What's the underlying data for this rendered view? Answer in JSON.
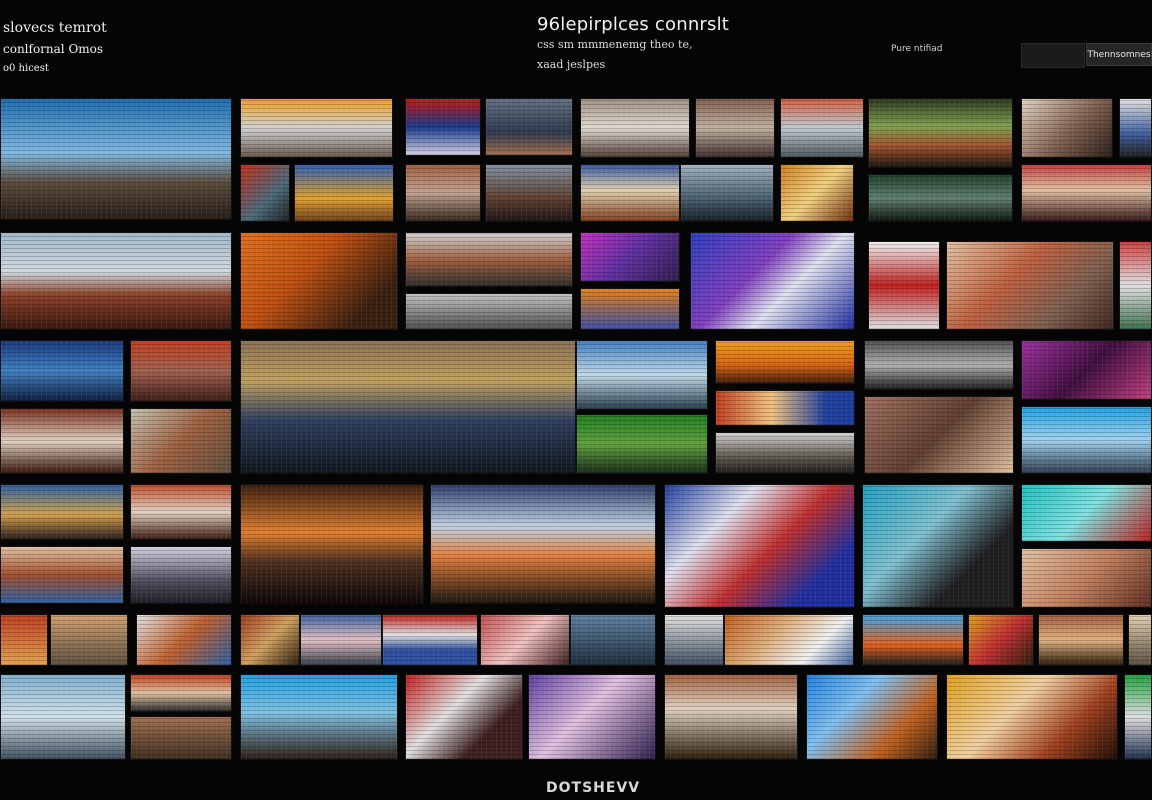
{
  "header": {
    "title_line1": "slovecs temrot",
    "title_line2": "conlfornal Omos",
    "title_line3": "o0 hicest",
    "center_title": "96lepirplces connrslt",
    "center_sub1": "css sm mmmenemg theo te,",
    "center_sub2": "xaad jeslpes",
    "sort_label": "Pure ntifiad",
    "action_label": "Thennsomnes"
  },
  "footer": {
    "label": "DOTSHEVV"
  },
  "colors": {
    "background": "#050505",
    "text": "#f2f2f2"
  }
}
